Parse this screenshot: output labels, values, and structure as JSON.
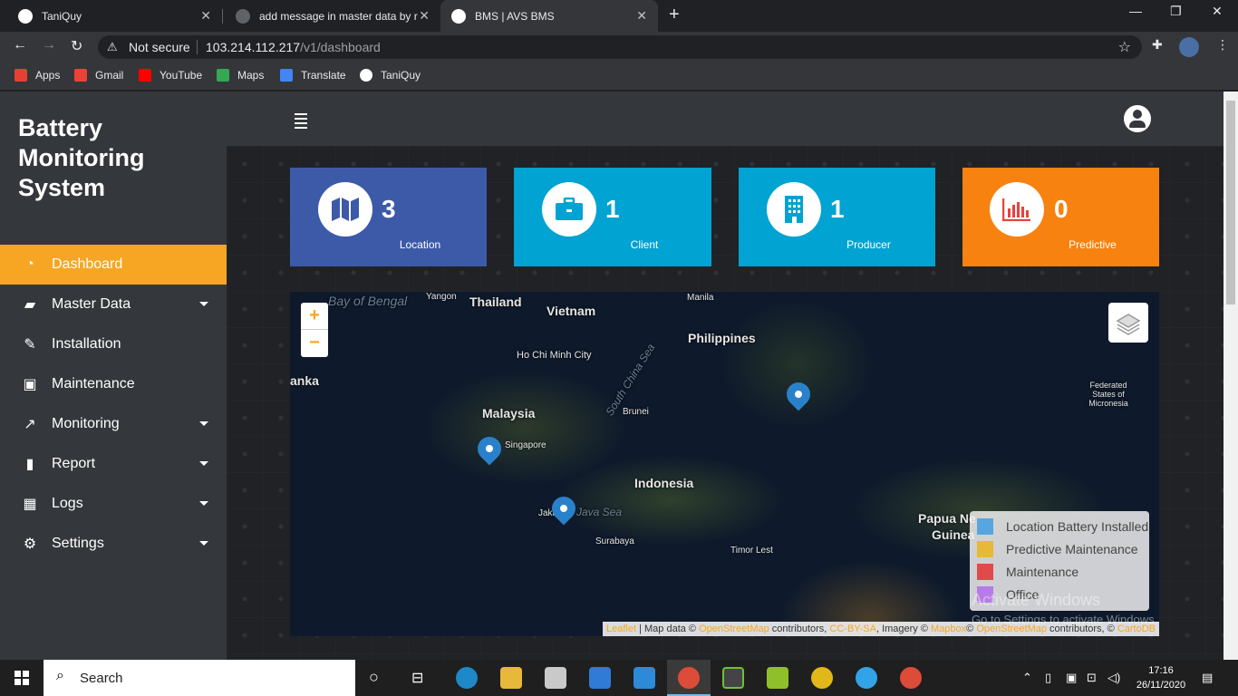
{
  "browser": {
    "tabs": [
      {
        "title": "TaniQuy",
        "favicon_color": "#ffffff"
      },
      {
        "title": "add message in master data by r",
        "favicon_color": "#5f6368"
      },
      {
        "title": "BMS | AVS BMS",
        "favicon_color": "#ffffff"
      }
    ],
    "new_tab": "+",
    "security_label": "Not secure",
    "url_host": "103.214.112.217",
    "url_path": "/v1/dashboard",
    "bookmarks": [
      {
        "label": "Apps",
        "color": "#e44134"
      },
      {
        "label": "Gmail",
        "color": "#ea4335"
      },
      {
        "label": "YouTube",
        "color": "#ff0000"
      },
      {
        "label": "Maps",
        "color": "#34a853"
      },
      {
        "label": "Translate",
        "color": "#4285f4"
      },
      {
        "label": "TaniQuy",
        "color": "#ffffff"
      }
    ]
  },
  "app": {
    "brand": "Battery Monitoring System",
    "accent": "#f6a623",
    "menu": [
      {
        "label": "Dashboard",
        "icon": "dashboard-gauge-icon",
        "glyph": "◔",
        "active": true,
        "has_caret": false
      },
      {
        "label": "Master Data",
        "icon": "folder-open-icon",
        "glyph": "▰",
        "active": false,
        "has_caret": true
      },
      {
        "label": "Installation",
        "icon": "wrench-icon",
        "glyph": "✎",
        "active": false,
        "has_caret": false
      },
      {
        "label": "Maintenance",
        "icon": "toolbox-icon",
        "glyph": "▣",
        "active": false,
        "has_caret": false
      },
      {
        "label": "Monitoring",
        "icon": "line-chart-icon",
        "glyph": "↗",
        "active": false,
        "has_caret": true
      },
      {
        "label": "Report",
        "icon": "file-icon",
        "glyph": "▮",
        "active": false,
        "has_caret": true
      },
      {
        "label": "Logs",
        "icon": "table-icon",
        "glyph": "▦",
        "active": false,
        "has_caret": true
      },
      {
        "label": "Settings",
        "icon": "cogs-icon",
        "glyph": "⚙",
        "active": false,
        "has_caret": true
      }
    ],
    "cards": [
      {
        "value": "3",
        "label": "Location",
        "color": "#3d5aa8",
        "icon": "map-icon"
      },
      {
        "value": "1",
        "label": "Client",
        "color": "#00a3d1",
        "icon": "briefcase-icon"
      },
      {
        "value": "1",
        "label": "Producer",
        "color": "#00a3d1",
        "icon": "building-icon"
      },
      {
        "value": "0",
        "label": "Predictive",
        "color": "#f7820f",
        "icon": "bar-chart-icon"
      }
    ],
    "map": {
      "labels": [
        {
          "text": "Thailand",
          "kind": "country"
        },
        {
          "text": "Vietnam",
          "kind": "country"
        },
        {
          "text": "Philippines",
          "kind": "country"
        },
        {
          "text": "Malaysia",
          "kind": "country"
        },
        {
          "text": "Indonesia",
          "kind": "country"
        },
        {
          "text": "Papua Ne",
          "kind": "country"
        },
        {
          "text": "Guinea",
          "kind": "country"
        },
        {
          "text": "Manila",
          "kind": "city"
        },
        {
          "text": "Ho Chi Minh City",
          "kind": "city"
        },
        {
          "text": "Brunei",
          "kind": "city"
        },
        {
          "text": "Singapore",
          "kind": "city"
        },
        {
          "text": "Jakarta",
          "kind": "city"
        },
        {
          "text": "Surabaya",
          "kind": "city"
        },
        {
          "text": "Timor Lest",
          "kind": "city"
        },
        {
          "text": "Federated States of Micronesia",
          "kind": "city"
        },
        {
          "text": "Bay of Bengal",
          "kind": "sea"
        },
        {
          "text": "South China Sea",
          "kind": "sea"
        },
        {
          "text": "Java Sea",
          "kind": "sea"
        },
        {
          "text": "anka",
          "kind": "country"
        },
        {
          "text": "Yangon",
          "kind": "city"
        }
      ],
      "zoom_in": "+",
      "zoom_out": "−",
      "legend": [
        {
          "label": "Location Battery Installed",
          "color": "#58a6e0"
        },
        {
          "label": "Predictive Maintenance",
          "color": "#e6b93a"
        },
        {
          "label": "Maintenance",
          "color": "#e04a4a"
        },
        {
          "label": "Office",
          "color": "#b77be8"
        }
      ],
      "attribution": {
        "leaflet": "Leaflet",
        "text1": " | Map data © ",
        "osm": "OpenStreetMap",
        "text2": " contributors, ",
        "ccbysa": "CC-BY-SA",
        "text3": ", Imagery © ",
        "mapbox": "Mapbox",
        "text4": "© ",
        "osm2": "OpenStreetMap",
        "text5": " contributors, © ",
        "carto": "CartoDB"
      }
    },
    "watermark_title": "Activate Windows",
    "watermark_sub": "Go to Settings to activate Windows."
  },
  "taskbar": {
    "search_placeholder": "Search",
    "time": "17:16",
    "date": "26/11/2020"
  }
}
